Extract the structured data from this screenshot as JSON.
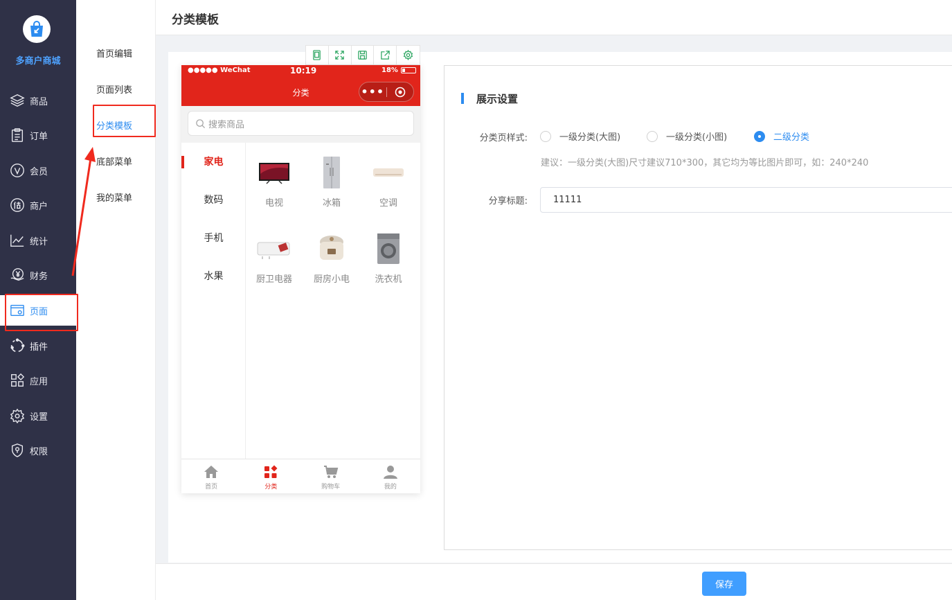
{
  "app": {
    "logo_text": "多商户商城",
    "page_title": "分类模板"
  },
  "sidebar": {
    "items": [
      {
        "label": "商品",
        "icon": "layers-icon"
      },
      {
        "label": "订单",
        "icon": "clipboard-icon"
      },
      {
        "label": "会员",
        "icon": "member-v-icon"
      },
      {
        "label": "商户",
        "icon": "supplier-icon"
      },
      {
        "label": "统计",
        "icon": "chart-line-icon"
      },
      {
        "label": "财务",
        "icon": "yen-hand-icon"
      },
      {
        "label": "页面",
        "icon": "page-settings-icon",
        "active": true
      },
      {
        "label": "插件",
        "icon": "plugin-ring-icon"
      },
      {
        "label": "应用",
        "icon": "apps-grid-icon"
      },
      {
        "label": "设置",
        "icon": "gear-icon"
      },
      {
        "label": "权限",
        "icon": "shield-icon"
      }
    ]
  },
  "submenu": {
    "items": [
      {
        "label": "首页编辑"
      },
      {
        "label": "页面列表"
      },
      {
        "label": "分类模板",
        "active": true
      },
      {
        "label": "底部菜单"
      },
      {
        "label": "我的菜单"
      }
    ]
  },
  "phone": {
    "status": {
      "carrier": "●●●●● WeChat",
      "time": "10:19",
      "battery": "18%"
    },
    "nav_title": "分类",
    "capsule_dots": "•••",
    "search_placeholder": "搜索商品",
    "categories": [
      {
        "label": "家电",
        "active": true
      },
      {
        "label": "数码"
      },
      {
        "label": "手机"
      },
      {
        "label": "水果"
      }
    ],
    "products": [
      {
        "name": "电视"
      },
      {
        "name": "冰箱"
      },
      {
        "name": "空调"
      },
      {
        "name": "厨卫电器"
      },
      {
        "name": "厨房小电"
      },
      {
        "name": "洗衣机"
      }
    ],
    "tabbar": [
      {
        "label": "首页"
      },
      {
        "label": "分类",
        "active": true
      },
      {
        "label": "购物车"
      },
      {
        "label": "我的"
      }
    ]
  },
  "settings": {
    "section_title": "展示设置",
    "style_label": "分类页样式:",
    "style_options": [
      {
        "label": "一级分类(大图)",
        "checked": false
      },
      {
        "label": "一级分类(小图)",
        "checked": false
      },
      {
        "label": "二级分类",
        "checked": true
      }
    ],
    "hint": "建议：一级分类(大图)尺寸建议710*300，其它均为等比图片即可，如：240*240",
    "share_label": "分享标题:",
    "share_value": "11111"
  },
  "footer": {
    "save_label": "保存"
  },
  "colors": {
    "sidebar_bg": "#2f3147",
    "accent": "#2d8cf0",
    "phone_red": "#e1251b",
    "save_button": "#409eff",
    "annotation_red": "#f02a1e"
  }
}
